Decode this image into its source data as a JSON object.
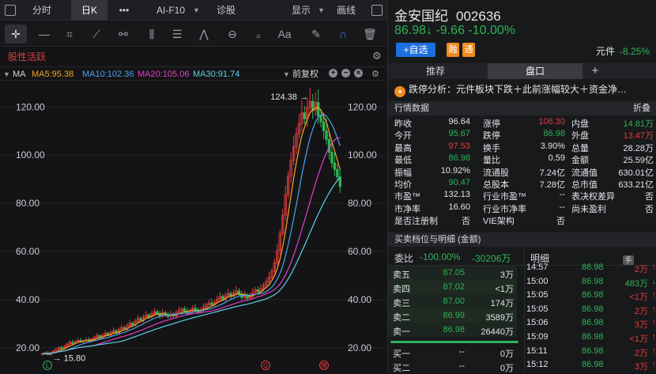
{
  "topbar": {
    "tabs": [
      "分时",
      "日K",
      "•••",
      "AI-F10",
      "诊股"
    ],
    "active_tab": "日K",
    "display_label": "显示",
    "draw_label": "画线"
  },
  "strategy_label": "股性活跃",
  "ma": {
    "label": "MA",
    "items": [
      {
        "text": "MA5:95.38",
        "color": "#f5a623"
      },
      {
        "text": "MA10:102.36",
        "color": "#4aa3f0"
      },
      {
        "text": "MA20:105.06",
        "color": "#e040c8"
      },
      {
        "text": "MA30:91.74",
        "color": "#5ad2e6"
      }
    ],
    "fq_label": "前复权"
  },
  "chart_data": {
    "type": "candlestick",
    "y_ticks": [
      20,
      40,
      60,
      80,
      100,
      120
    ],
    "ylim": [
      15,
      128
    ],
    "y_tick_labels": [
      "20.00",
      "40.00",
      "60.00",
      "80.00",
      "100.00",
      "120.00"
    ],
    "high_label": "124.38",
    "low_label": "15.80",
    "closes": [
      17.5,
      17.8,
      17.2,
      18.0,
      18.6,
      19.2,
      20.1,
      19.6,
      20.4,
      21.5,
      22.3,
      21.8,
      22.6,
      23.1,
      22.5,
      22.9,
      23.4,
      22.8,
      23.6,
      24.2,
      25.0,
      24.3,
      25.1,
      26.0,
      25.4,
      26.3,
      27.1,
      26.2,
      27.5,
      28.4,
      27.8,
      29.1,
      30.2,
      29.5,
      31.0,
      32.2,
      31.4,
      32.8,
      33.6,
      32.9,
      34.1,
      35.0,
      34.2,
      33.1,
      34.5,
      33.8,
      32.9,
      34.0,
      33.2,
      34.6,
      35.4,
      36.1,
      35.2,
      34.3,
      35.5,
      36.4,
      35.8,
      34.9,
      35.6,
      36.8,
      37.9,
      38.6,
      37.7,
      38.9,
      40.2,
      41.3,
      40.1,
      41.6,
      42.5,
      41.4,
      42.8,
      43.6,
      42.1,
      40.9,
      41.8,
      40.6,
      41.5,
      42.9,
      44.1,
      43.2,
      44.6,
      46.0,
      47.5,
      49.3,
      51.8,
      55.2,
      60.4,
      67.5,
      75.1,
      83.6,
      91.2,
      97.8,
      103.5,
      108.9,
      113.2,
      117.6,
      115.1,
      119.8,
      122.4,
      118.6,
      121.9,
      116.4,
      113.8,
      110.2,
      106.5,
      101.2,
      96.8,
      94.1,
      91.0,
      86.98
    ],
    "ma5_last": 95.38,
    "ma10_last": 102.36,
    "ma20_last": 105.06,
    "ma30_last": 91.74,
    "markers": [
      "L",
      "Q",
      "榜"
    ]
  },
  "stock": {
    "name": "金安国纪",
    "code": "002636",
    "price": "86.98",
    "arrow": "↓",
    "change": "-9.66",
    "pct": "-10.00%",
    "add_label": "+自选",
    "badge1": "融",
    "badge2": "通",
    "sector_name": "元件",
    "sector_pct": "-8.25%"
  },
  "right_tabs": [
    "推荐",
    "盘口",
    "+"
  ],
  "analysis_text": "跌停分析：元件板块下跌＋此前涨幅较大＋资金净…",
  "quote_header": {
    "title": "行情数据",
    "fold": "折叠"
  },
  "stats": [
    [
      {
        "k": "昨收",
        "v": "96.64",
        "c": "white"
      },
      {
        "k": "涨停",
        "v": "106.30",
        "c": "red"
      },
      {
        "k": "内盘",
        "v": "14.81万",
        "c": "green"
      }
    ],
    [
      {
        "k": "今开",
        "v": "95.67",
        "c": "green"
      },
      {
        "k": "跌停",
        "v": "86.98",
        "c": "green"
      },
      {
        "k": "外盘",
        "v": "13.47万",
        "c": "red"
      }
    ],
    [
      {
        "k": "最高",
        "v": "97.53",
        "c": "red"
      },
      {
        "k": "换手",
        "v": "3.90%",
        "c": "white"
      },
      {
        "k": "总量",
        "v": "28.28万",
        "c": "white"
      }
    ],
    [
      {
        "k": "最低",
        "v": "86.98",
        "c": "green"
      },
      {
        "k": "量比",
        "v": "0.59",
        "c": "white"
      },
      {
        "k": "金额",
        "v": "25.59亿",
        "c": "white"
      }
    ],
    [
      {
        "k": "振幅",
        "v": "10.92%",
        "c": "white"
      },
      {
        "k": "流通股",
        "v": "7.24亿",
        "c": "white"
      },
      {
        "k": "流通值",
        "v": "630.01亿",
        "c": "white"
      }
    ],
    [
      {
        "k": "均价",
        "v": "90.47",
        "c": "green"
      },
      {
        "k": "总股本",
        "v": "7.28亿",
        "c": "white"
      },
      {
        "k": "总市值",
        "v": "633.21亿",
        "c": "white"
      }
    ],
    [
      {
        "k": "市盈™",
        "v": "132.13",
        "c": "white"
      },
      {
        "k": "行业市盈™",
        "v": "--",
        "c": "white"
      },
      {
        "k": "表决权差异",
        "v": "否",
        "c": "white"
      }
    ],
    [
      {
        "k": "市净率",
        "v": "16.60",
        "c": "white"
      },
      {
        "k": "行业市净率",
        "v": "--",
        "c": "white"
      },
      {
        "k": "尚未盈利",
        "v": "否",
        "c": "white"
      }
    ],
    [
      {
        "k": "是否注册制",
        "v": "否",
        "c": "white"
      },
      {
        "k": "VIE架构",
        "v": "否",
        "c": "white"
      },
      {
        "k": "",
        "v": "",
        "c": "white"
      }
    ]
  ],
  "ob_header": {
    "title": "买卖档位与明细 (金额)",
    "hand": "手"
  },
  "ob_summary": {
    "label": "委比",
    "ratio": "-100.00%",
    "diff": "-30206万",
    "detail": "明细"
  },
  "asks": [
    {
      "label": "卖五",
      "price": "87.05",
      "amt": "3万"
    },
    {
      "label": "卖四",
      "price": "87.02",
      "amt": "<1万"
    },
    {
      "label": "卖三",
      "price": "87.00",
      "amt": "174万"
    },
    {
      "label": "卖二",
      "price": "86.99",
      "amt": "3589万"
    },
    {
      "label": "卖一",
      "price": "86.98",
      "amt": "26440万"
    }
  ],
  "bids": [
    {
      "label": "买一",
      "price": "--",
      "amt": "0万"
    },
    {
      "label": "买二",
      "price": "--",
      "amt": "0万"
    }
  ],
  "ticks": [
    {
      "t": "14:57",
      "p": "86.98",
      "v": "2万",
      "d": "↑",
      "c": "red"
    },
    {
      "t": "15:00",
      "p": "86.98",
      "v": "483万",
      "d": "↓",
      "c": "green"
    },
    {
      "t": "15:05",
      "p": "86.98",
      "v": "<1万",
      "d": "↑",
      "c": "red"
    },
    {
      "t": "15:05",
      "p": "86.98",
      "v": "2万",
      "d": "↑",
      "c": "red"
    },
    {
      "t": "15:06",
      "p": "86.98",
      "v": "3万",
      "d": "↑",
      "c": "red"
    },
    {
      "t": "15:09",
      "p": "86.98",
      "v": "<1万",
      "d": "↑",
      "c": "red"
    },
    {
      "t": "15:11",
      "p": "86.98",
      "v": "2万",
      "d": "↑",
      "c": "red"
    },
    {
      "t": "15:12",
      "p": "86.98",
      "v": "3万",
      "d": "↑",
      "c": "red"
    }
  ]
}
